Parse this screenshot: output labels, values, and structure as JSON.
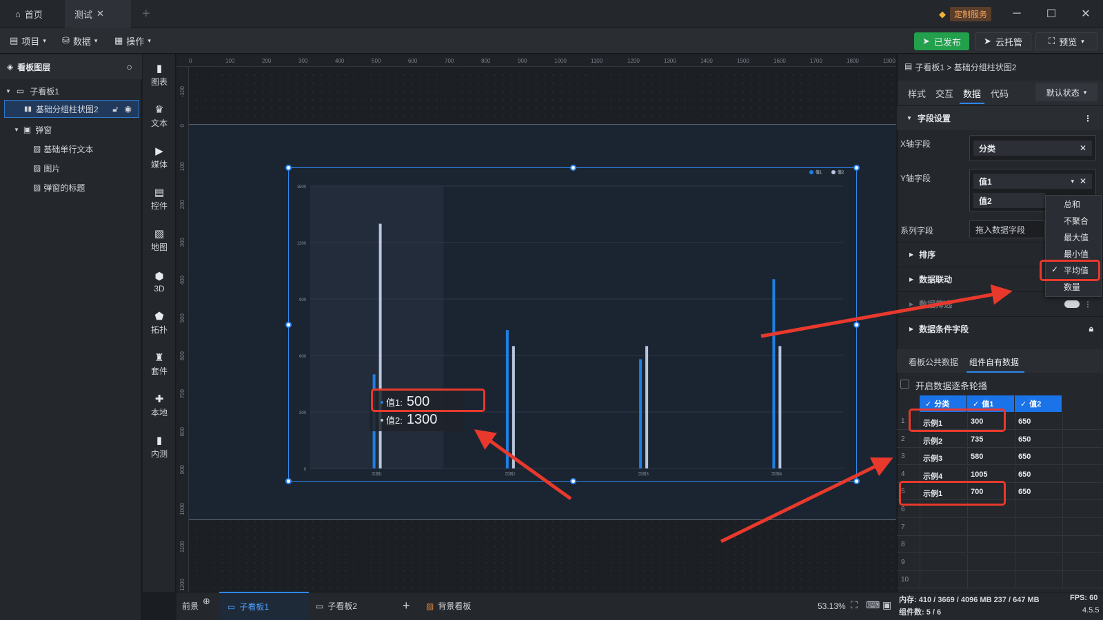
{
  "titlebar": {
    "tabs": [
      {
        "label": "首页"
      },
      {
        "label": "测试"
      }
    ],
    "service": "定制服务"
  },
  "menubar": {
    "items": [
      {
        "label": "项目"
      },
      {
        "label": "数据"
      },
      {
        "label": "操作"
      }
    ],
    "published": "已发布",
    "cloud": "云托管",
    "preview": "预览"
  },
  "layers": {
    "title": "看板图层",
    "items": [
      {
        "label": "子看板1"
      },
      {
        "label": "基础分组柱状图2"
      },
      {
        "label": "弹窗"
      },
      {
        "label": "基础单行文本"
      },
      {
        "label": "图片"
      },
      {
        "label": "弹窗的标题"
      }
    ]
  },
  "tools": [
    {
      "label": "图表"
    },
    {
      "label": "文本"
    },
    {
      "label": "媒体"
    },
    {
      "label": "控件"
    },
    {
      "label": "地图"
    },
    {
      "label": "3D"
    },
    {
      "label": "拓扑"
    },
    {
      "label": "套件"
    },
    {
      "label": "本地"
    },
    {
      "label": "内测"
    }
  ],
  "ruler": {
    "top": [
      "0",
      "100",
      "200",
      "300",
      "400",
      "500",
      "600",
      "700",
      "800",
      "900",
      "1000",
      "1100",
      "1200",
      "1300",
      "1400",
      "1500",
      "1600",
      "1700",
      "1800",
      "1900"
    ],
    "left": [
      "-100",
      "0",
      "100",
      "200",
      "300",
      "400",
      "500",
      "600",
      "700",
      "800",
      "900",
      "1000",
      "1100",
      "1200"
    ]
  },
  "chart_data": {
    "type": "bar",
    "categories": [
      "示例1",
      "示例2",
      "示例3",
      "示例4"
    ],
    "series": [
      {
        "name": "值1",
        "values": [
          500,
          735,
          580,
          1005
        ]
      },
      {
        "name": "值2",
        "values": [
          1300,
          650,
          650,
          650
        ]
      }
    ],
    "yticks": [
      "0",
      "300",
      "600",
      "900",
      "1200",
      "1500"
    ],
    "ylim": [
      0,
      1500
    ],
    "tooltip": {
      "label1": "值1:",
      "value1": "500",
      "label2": "值2:",
      "value2": "1300"
    },
    "colors": {
      "s1": "#1f7fe3",
      "s2": "#b8c7dd"
    },
    "legend": "top-right",
    "grid": true
  },
  "right": {
    "breadcrumb": "子看板1 > 基础分组柱状图2",
    "tabs": [
      "样式",
      "交互",
      "数据",
      "代码"
    ],
    "state": "默认状态",
    "sections": {
      "fields": "字段设置",
      "sort": "排序",
      "link": "数据联动",
      "filter": "数据筛选",
      "condition": "数据条件字段"
    },
    "x_label": "X轴字段",
    "x_value": "分类",
    "y_label": "Y轴字段",
    "y_values": [
      "值1",
      "值2"
    ],
    "series_label": "系列字段",
    "series_placeholder": "拖入数据字段",
    "agg_options": [
      "总和",
      "不聚合",
      "最大值",
      "最小值",
      "平均值",
      "数量"
    ],
    "data_tabs": [
      "看板公共数据",
      "组件自有数据"
    ],
    "carousel": "开启数据逐条轮播",
    "table": {
      "headers": [
        "分类",
        "值1",
        "值2"
      ],
      "rows": [
        [
          "示例1",
          "300",
          "650"
        ],
        [
          "示例2",
          "735",
          "650"
        ],
        [
          "示例3",
          "580",
          "650"
        ],
        [
          "示例4",
          "1005",
          "650"
        ],
        [
          "示例1",
          "700",
          "650"
        ]
      ],
      "rownums": [
        "1",
        "2",
        "3",
        "4",
        "5",
        "6",
        "7",
        "8",
        "9",
        "10"
      ]
    }
  },
  "bottom": {
    "foreground": "前景",
    "boards": [
      "子看板1",
      "子看板2"
    ],
    "background": "背景看板",
    "zoom": "53.13%",
    "memory": "内存: 410 / 3669 / 4096 MB  237 / 647 MB",
    "fps": "FPS: 60",
    "components": "组件数: 5 / 6",
    "version": "4.5.5"
  }
}
